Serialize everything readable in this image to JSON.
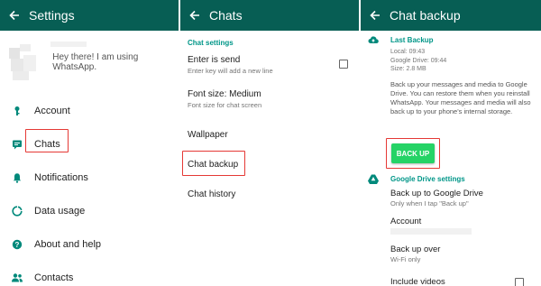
{
  "settings_panel": {
    "title": "Settings",
    "status": "Hey there! I am using WhatsApp.",
    "items": [
      {
        "label": "Account",
        "icon": "key-icon"
      },
      {
        "label": "Chats",
        "icon": "chat-icon"
      },
      {
        "label": "Notifications",
        "icon": "bell-icon"
      },
      {
        "label": "Data usage",
        "icon": "data-usage-icon"
      },
      {
        "label": "About and help",
        "icon": "help-icon"
      },
      {
        "label": "Contacts",
        "icon": "contacts-icon"
      }
    ]
  },
  "chats_panel": {
    "title": "Chats",
    "section": "Chat settings",
    "enter_is_send": {
      "title": "Enter is send",
      "subtitle": "Enter key will add a new line",
      "checked": false
    },
    "font_size": {
      "title": "Font size: Medium",
      "subtitle": "Font size for chat screen"
    },
    "wallpaper": "Wallpaper",
    "chat_backup": "Chat backup",
    "chat_history": "Chat history"
  },
  "backup_panel": {
    "title": "Chat backup",
    "last_backup": {
      "heading": "Last Backup",
      "local": "Local: 09:43",
      "google_drive": "Google Drive: 09:44",
      "size": "Size: 2.8 MB"
    },
    "description": "Back up your messages and media to Google Drive. You can restore them when you reinstall WhatsApp. Your messages and media will also back up to your phone's internal storage.",
    "backup_button": "BACK UP",
    "drive_settings": {
      "heading": "Google Drive settings",
      "backup_to_drive": {
        "title": "Back up to Google Drive",
        "subtitle": "Only when I tap \"Back up\""
      },
      "account": {
        "title": "Account"
      },
      "backup_over": {
        "title": "Back up over",
        "subtitle": "Wi-Fi only"
      },
      "include_videos": {
        "title": "Include videos",
        "checked": false
      }
    }
  },
  "colors": {
    "appbar": "#075e54",
    "accent": "#009688",
    "button": "#25d366",
    "highlight": "#e53935"
  }
}
